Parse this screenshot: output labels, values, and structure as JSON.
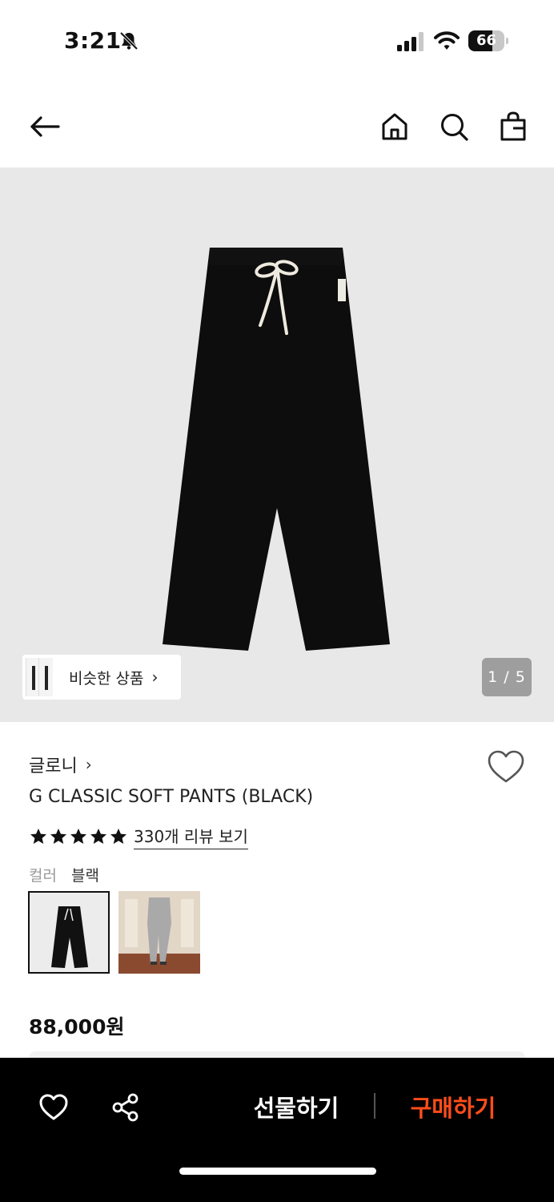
{
  "status_bar": {
    "time": "3:21",
    "battery_level": "66",
    "icons": [
      "bell-slash-icon",
      "cellular-signal-icon",
      "wifi-icon",
      "battery-icon"
    ]
  },
  "header": {
    "icons": [
      "back-arrow-icon",
      "home-icon",
      "search-icon",
      "shopping-bag-icon"
    ]
  },
  "gallery": {
    "similar_label": "비슷한 상품",
    "similar_chevron": "›",
    "page_indicator": "1 / 5",
    "current_page": 1,
    "total_pages": 5
  },
  "product": {
    "brand": "글로니",
    "brand_chevron": "›",
    "title": "G CLASSIC SOFT PANTS (BLACK)",
    "rating_stars": 5,
    "review_link": "330개 리뷰 보기",
    "color_label": "컬러",
    "color_value": "블랙",
    "price": "88,000원"
  },
  "bottom_bar": {
    "gift_label": "선물하기",
    "buy_label": "구매하기",
    "buy_color": "#ff4d1a",
    "icons": [
      "heart-icon",
      "share-icon"
    ]
  }
}
